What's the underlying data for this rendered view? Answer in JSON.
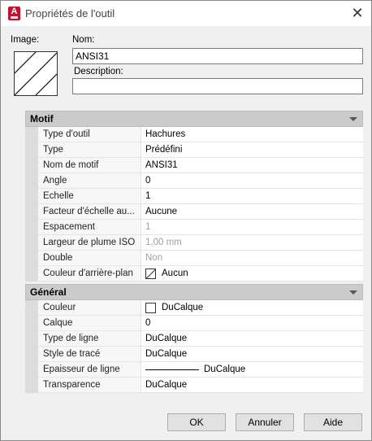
{
  "window": {
    "title": "Propriétés de l'outil",
    "app_icon_letter": "A",
    "close_glyph": "✕"
  },
  "image_label": "Image:",
  "name": {
    "label": "Nom:",
    "value": "ANSI31"
  },
  "description": {
    "label": "Description:",
    "value": ""
  },
  "motif": {
    "header": "Motif",
    "rows": [
      {
        "key": "Type d'outil",
        "value": "Hachures"
      },
      {
        "key": "Type",
        "value": "Prédéfini"
      },
      {
        "key": "Nom de motif",
        "value": "ANSI31"
      },
      {
        "key": "Angle",
        "value": "0"
      },
      {
        "key": "Echelle",
        "value": "1"
      },
      {
        "key": "Facteur d'échelle au...",
        "value": "Aucune"
      },
      {
        "key": "Espacement",
        "value": "1"
      },
      {
        "key": "Largeur de plume ISO",
        "value": "1,00 mm"
      },
      {
        "key": "Double",
        "value": "Non"
      },
      {
        "key": "Couleur d'arrière-plan",
        "value": "Aucun"
      }
    ]
  },
  "general": {
    "header": "Général",
    "rows": [
      {
        "key": "Couleur",
        "value": "DuCalque"
      },
      {
        "key": "Calque",
        "value": "0"
      },
      {
        "key": "Type de ligne",
        "value": "DuCalque"
      },
      {
        "key": "Style de tracé",
        "value": "DuCalque"
      },
      {
        "key": "Epaisseur de ligne",
        "value": "DuCalque"
      },
      {
        "key": "Transparence",
        "value": "DuCalque"
      }
    ]
  },
  "buttons": {
    "ok": "OK",
    "cancel": "Annuler",
    "help": "Aide"
  },
  "colors": {
    "accent_app_icon": "#c8102e",
    "section_header": "#cbcbcb",
    "dim_text": "#a0a0a0"
  }
}
